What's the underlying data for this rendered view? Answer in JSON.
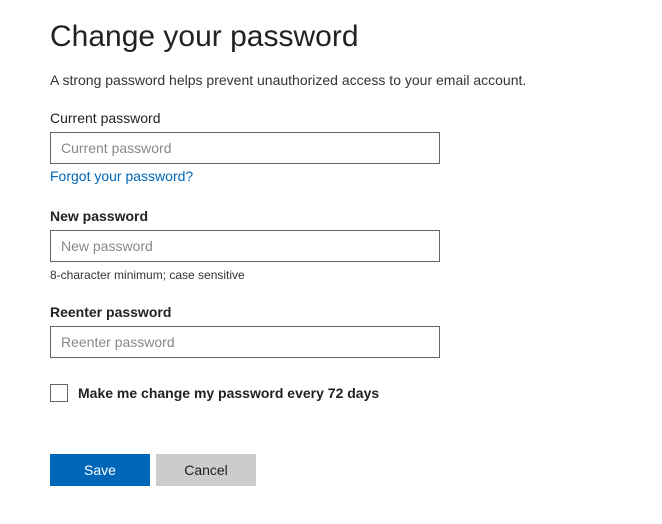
{
  "title": "Change your password",
  "intro": "A strong password helps prevent unauthorized access to your email account.",
  "current": {
    "label": "Current password",
    "placeholder": "Current password",
    "value": "",
    "forgot_link": "Forgot your password?"
  },
  "new": {
    "label": "New password",
    "placeholder": "New password",
    "value": "",
    "hint": "8-character minimum; case sensitive"
  },
  "reenter": {
    "label": "Reenter password",
    "placeholder": "Reenter password",
    "value": ""
  },
  "checkbox": {
    "label": "Make me change my password every 72 days",
    "checked": false
  },
  "buttons": {
    "save": "Save",
    "cancel": "Cancel"
  }
}
